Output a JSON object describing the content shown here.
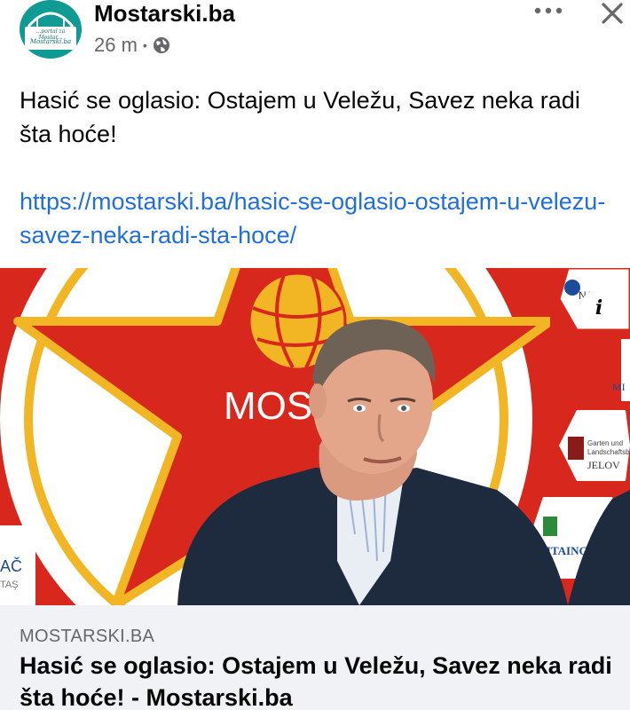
{
  "header": {
    "page_name": "Mostarski.ba",
    "time": "26 m",
    "separator": "•",
    "privacy_icon": "globe-icon",
    "more_icon": "more-horizontal-icon",
    "close_icon": "close-icon",
    "avatar": {
      "tagline": "...portal za Mostar...",
      "brand": "Mostarski.ba",
      "color": "#0f9a94"
    }
  },
  "post": {
    "text": "Hasić se oglasio: Ostajem u Veležu, Savez neka radi šta hoće!",
    "link": "https://mostarski.ba/hasic-se-oglasio-ostajem-u-velezu-savez-neka-radi-sta-hoce/",
    "link_color": "#216fdb"
  },
  "photo": {
    "backdrop_text": "MOS",
    "sponsors": [
      "NALI",
      "MI",
      "Garten und Landschaftsbau",
      "JELOV",
      "STITAING",
      "AČ",
      "TAŞ"
    ],
    "info_icon": "info-icon",
    "info_label": "i",
    "colors": {
      "red": "#d8281e",
      "gold": "#f2b624",
      "white": "#ffffff"
    }
  },
  "link_card": {
    "domain": "MOSTARSKI.BA",
    "title": "Hasić se oglasio: Ostajem u Veležu, Savez neka radi šta hoće! - Mostarski.ba"
  }
}
